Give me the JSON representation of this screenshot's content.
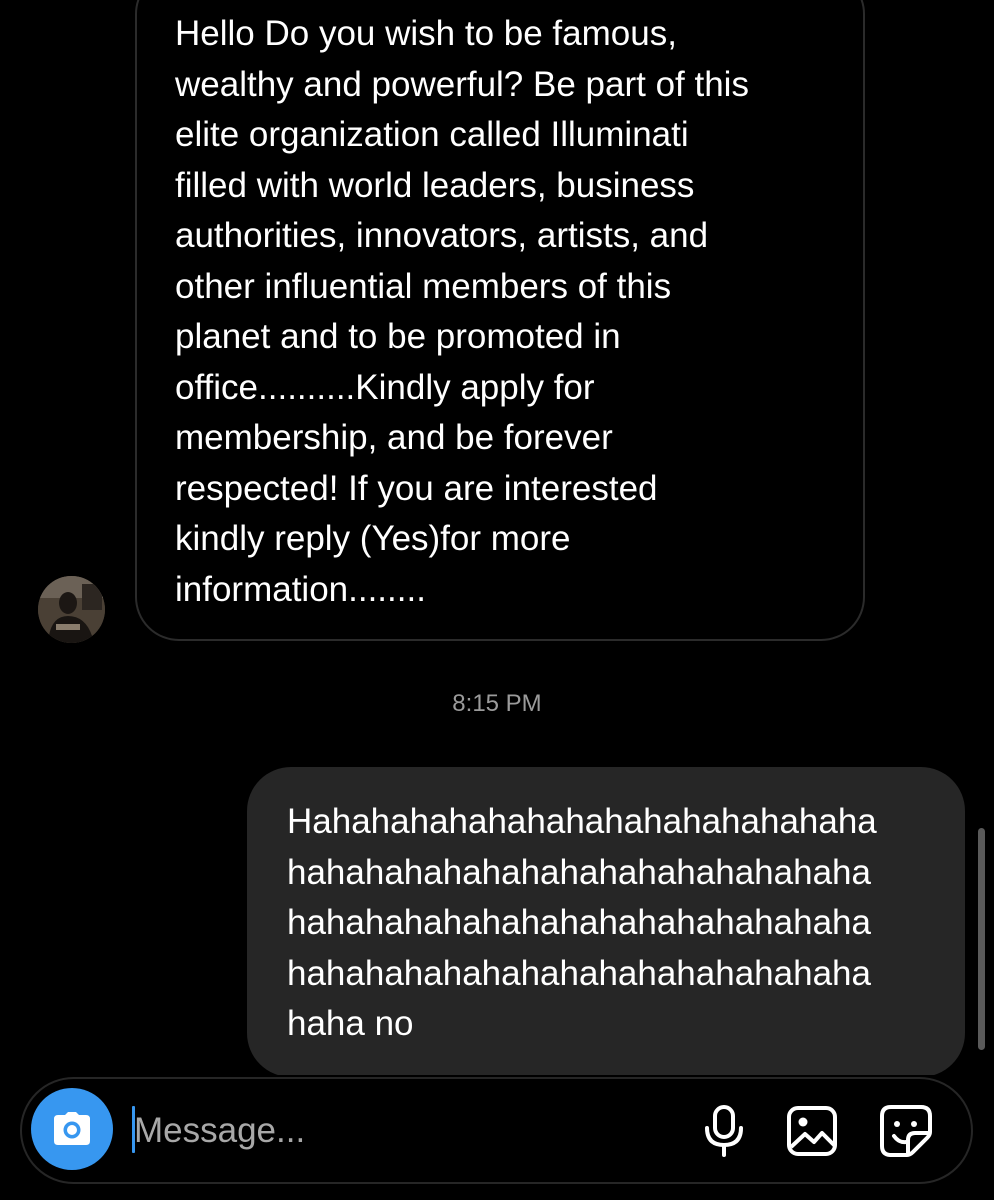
{
  "thread": {
    "received_message": {
      "text": "Hello Do you wish to be famous,\nwealthy and powerful? Be part of this\nelite organization called Illuminati\nfilled with world leaders, business\nauthorities, innovators, artists, and\nother influential members of this\nplanet and to be promoted in\noffice..........Kindly apply for\nmembership,  and be forever\nrespected! If you are interested\nkindly reply (Yes)for more\ninformation........"
    },
    "timestamp": "8:15 PM",
    "sent_message": {
      "text": "Hahahahahahahahahahahahahahaha\nhahahahahahahahahahahahahahaha\nhahahahahahahahahahahahahahaha\nhahahahahahahahahahahahahahaha\nhaha no"
    }
  },
  "composer": {
    "placeholder": "Message...",
    "value": "",
    "icons": {
      "camera": "camera-icon",
      "microphone": "microphone-icon",
      "gallery": "image-icon",
      "sticker": "sticker-icon"
    }
  },
  "colors": {
    "background": "#000000",
    "sent_bubble": "#262626",
    "received_border": "#2b2b2b",
    "accent": "#3797f0",
    "timestamp": "#9b9b9b"
  }
}
